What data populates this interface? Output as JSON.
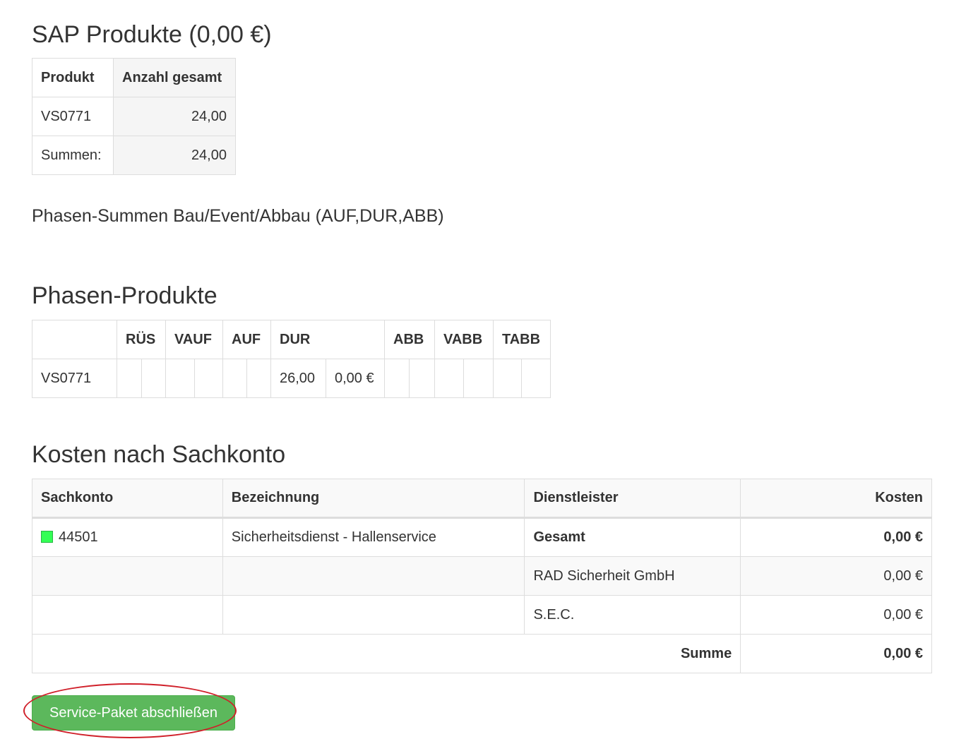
{
  "sap": {
    "title": "SAP Produkte (0,00 €)",
    "headers": [
      "Produkt",
      "Anzahl gesamt"
    ],
    "rows": [
      [
        "VS0771",
        "24,00"
      ],
      [
        "Summen:",
        "24,00"
      ]
    ]
  },
  "phase_sums": {
    "title": "Phasen-Summen Bau/Event/Abbau (AUF,DUR,ABB)"
  },
  "phase_products": {
    "title": "Phasen-Produkte",
    "headers": [
      "",
      "RÜS",
      "VAUF",
      "AUF",
      "DUR",
      "ABB",
      "VABB",
      "TABB"
    ],
    "row": {
      "product": "VS0771",
      "dur_qty": "26,00",
      "dur_cost": "0,00 €"
    }
  },
  "costs": {
    "title": "Kosten nach Sachkonto",
    "headers": [
      "Sachkonto",
      "Bezeichnung",
      "Dienstleister",
      "Kosten"
    ],
    "account": "44501",
    "account_color": "#33ff55",
    "description": "Sicherheitsdienst - Hallenservice",
    "rows": [
      {
        "provider": "Gesamt",
        "cost": "0,00 €"
      },
      {
        "provider": "RAD Sicherheit GmbH",
        "cost": "0,00 €"
      },
      {
        "provider": "S.E.C.",
        "cost": "0,00 €"
      }
    ],
    "sum_label": "Summe",
    "sum_value": "0,00 €"
  },
  "actions": {
    "submit_label": "Service-Paket abschließen"
  }
}
